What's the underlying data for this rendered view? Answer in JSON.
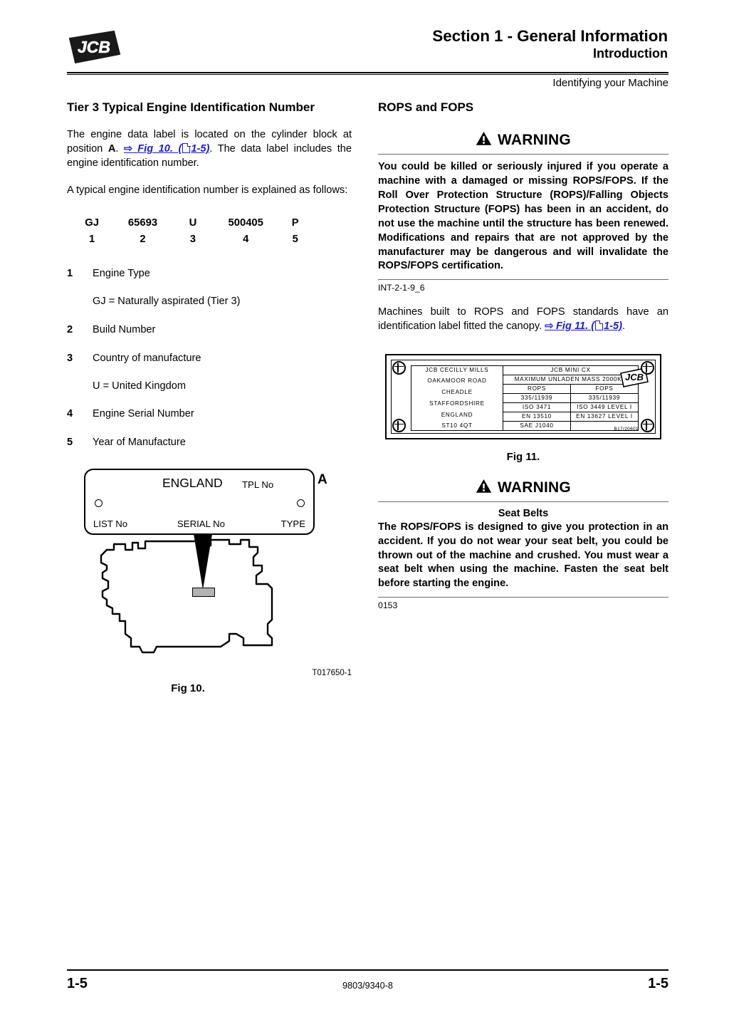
{
  "header": {
    "logo_text": "JCB",
    "title": "Section 1 - General Information",
    "subtitle": "Introduction",
    "running_head": "Identifying your Machine"
  },
  "left_column": {
    "heading": "Tier 3 Typical Engine Identification Number",
    "para1_a": "The engine data label is located on the cylinder block at position ",
    "para1_bold": "A",
    "para1_b": ". ",
    "xref1": {
      "arrow": "⇨",
      "label": "Fig 10. (",
      "page": "1-5)"
    },
    "para1_c": ". The data label includes the engine identification number.",
    "para2": "A typical engine identification number is explained as follows:",
    "id_number": {
      "parts": [
        "GJ",
        "65693",
        "U",
        "500405",
        "P"
      ],
      "indices": [
        "1",
        "2",
        "3",
        "4",
        "5"
      ]
    },
    "list": [
      {
        "num": "1",
        "text": "Engine Type",
        "sub": "GJ = Naturally aspirated (Tier 3)"
      },
      {
        "num": "2",
        "text": "Build Number",
        "sub": ""
      },
      {
        "num": "3",
        "text": "Country of manufacture",
        "sub": "U = United Kingdom"
      },
      {
        "num": "4",
        "text": "Engine Serial Number",
        "sub": ""
      },
      {
        "num": "5",
        "text": "Year of Manufacture",
        "sub": ""
      }
    ],
    "fig10": {
      "plate": {
        "england": "ENGLAND",
        "tpl_no": "TPL No",
        "list_no": "LIST No",
        "serial_no": "SERIAL No",
        "type": "TYPE"
      },
      "callout": "A",
      "drawing_code": "T017650-1",
      "caption": "Fig 10."
    }
  },
  "right_column": {
    "heading": "ROPS and FOPS",
    "warning1": {
      "title": "WARNING",
      "body": "You could be killed or seriously injured if you operate a machine with a damaged or missing ROPS/FOPS. If the Roll Over Protection Structure (ROPS)/Falling Objects Protection Structure (FOPS) has been in an accident, do not use the machine until the structure has been renewed. Modifications and repairs that are not approved by the manufacturer may be dangerous and will invalidate the ROPS/FOPS certification.",
      "code": "INT-2-1-9_6"
    },
    "para1_a": "Machines built to ROPS and FOPS standards have an identification label fitted the canopy. ",
    "xref2": {
      "arrow": "⇨",
      "label": "Fig 11. (",
      "page": "1-5)"
    },
    "para1_b": ".",
    "fig11": {
      "address": [
        "JCB CECILLY MILLS",
        "OAKAMOOR ROAD",
        "CHEADLE",
        "STAFFORDSHIRE",
        "ENGLAND",
        "ST10 4QT"
      ],
      "model": "JCB MINI CX",
      "mass": "MAXIMUM UNLADEN MASS 2000KG",
      "col_headers": [
        "ROPS",
        "FOPS"
      ],
      "rows": [
        [
          "335/11939",
          "335/11939"
        ],
        [
          "ISO 3471",
          "ISO 3449 LEVEL I"
        ],
        [
          "EN 13510",
          "EN 13627 LEVEL I"
        ],
        [
          "SAE J1040",
          ""
        ]
      ],
      "logo_text": "JCB",
      "drawing_code": "B17/20601",
      "caption": "Fig 11."
    },
    "warning2": {
      "title": "WARNING",
      "subtitle": "Seat Belts",
      "body": "The ROPS/FOPS is designed to give you protection in an accident. If you do not wear your seat belt, you could be thrown out of the machine and crushed. You must wear a seat belt when using the machine. Fasten the seat belt before starting the engine.",
      "code": "0153"
    }
  },
  "footer": {
    "page_left": "1-5",
    "doc_number": "9803/9340-8",
    "page_right": "1-5"
  }
}
